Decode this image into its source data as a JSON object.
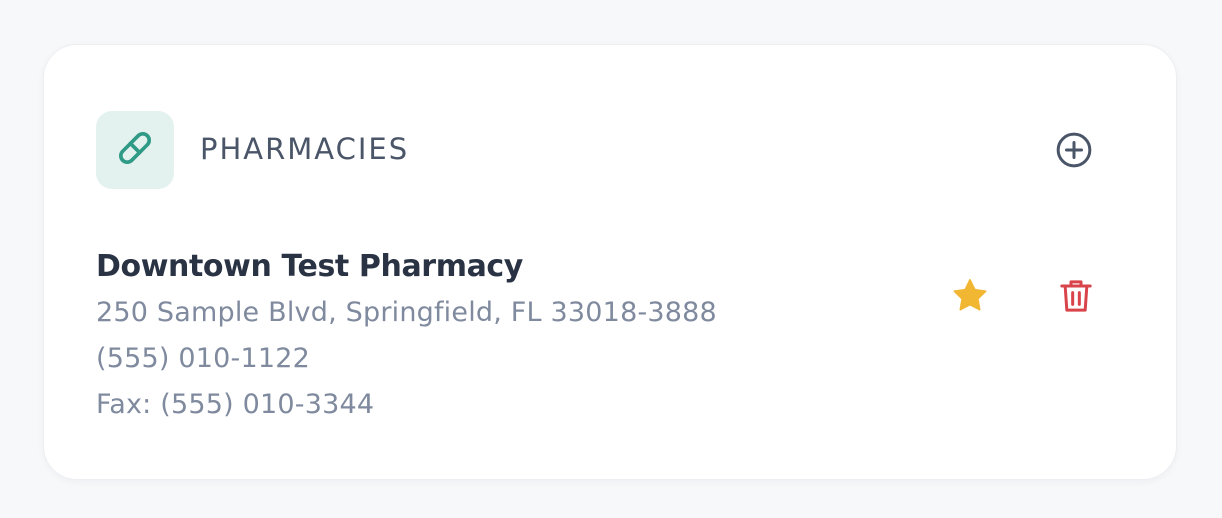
{
  "section": {
    "title": "PHARMACIES",
    "header_icon": "pill-icon",
    "add_icon": "plus-circle-icon"
  },
  "pharmacy": {
    "name": "Downtown Test Pharmacy",
    "address": "250 Sample Blvd, Springfield, FL 33018-3888",
    "phone": "(555) 010-1122",
    "fax": "Fax: (555) 010-3344",
    "favorite_icon": "star-icon",
    "delete_icon": "trash-icon"
  },
  "colors": {
    "accent_teal": "#2f9a86",
    "icon_bg": "#e4f2ef",
    "star": "#f1b733",
    "delete": "#d9434a",
    "title_text": "#4a5568",
    "name_text": "#2a3344",
    "muted_text": "#7f8a9e"
  }
}
